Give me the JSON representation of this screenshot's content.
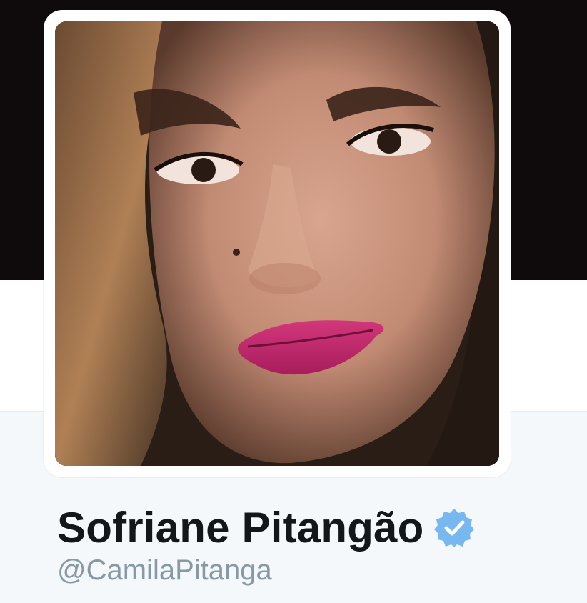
{
  "profile": {
    "display_name": "Sofriane Pitangão",
    "handle": "@CamilaPitanga",
    "verified": true,
    "avatar_alt": "profile photo"
  },
  "colors": {
    "banner": "#0f0a0b",
    "page_background": "#f5f8fa",
    "name_text": "#14171a",
    "handle_text": "#8899a6",
    "verified_badge": "#1da1f2"
  },
  "icons": {
    "verified": "verified-badge-icon"
  }
}
